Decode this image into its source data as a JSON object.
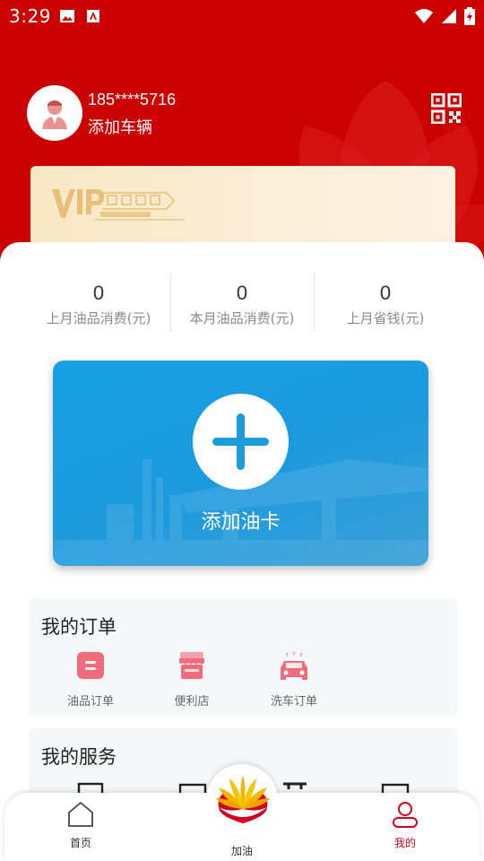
{
  "status_bar": {
    "time": "3:29"
  },
  "profile": {
    "phone": "185****5716",
    "add_vehicle": "添加车辆"
  },
  "stats": [
    {
      "value": "0",
      "label": "上月油品消费(元)"
    },
    {
      "value": "0",
      "label": "本月油品消费(元)"
    },
    {
      "value": "0",
      "label": "上月省钱(元)"
    }
  ],
  "oil_card": {
    "label": "添加油卡"
  },
  "orders": {
    "title": "我的订单",
    "items": [
      {
        "label": "油品订单"
      },
      {
        "label": "便利店"
      },
      {
        "label": "洗车订单"
      }
    ]
  },
  "services": {
    "title": "我的服务"
  },
  "tabbar": {
    "home": "首页",
    "refuel": "加油",
    "mine": "我的"
  },
  "colors": {
    "brand_red": "#cc0000",
    "card_blue": "#1b9ade",
    "active_tab": "#d0021b",
    "order_icon_pink": "#f26b7a"
  }
}
